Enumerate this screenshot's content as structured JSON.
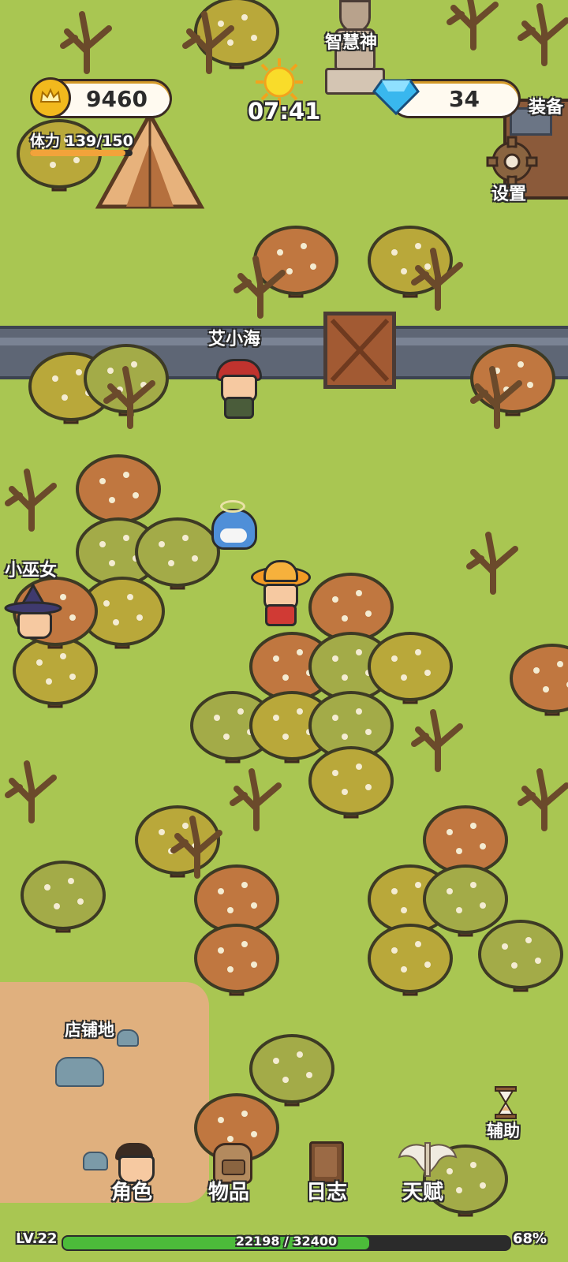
{
  "hud": {
    "gold": "9460",
    "gems": "34",
    "time": "07:41",
    "stamina_label": "体力 139/150",
    "stamina_fraction": 0.93,
    "settings_label": "设置",
    "equipment_label": "装备",
    "assist_label": "辅助"
  },
  "world": {
    "statue_label": "智慧神",
    "npc_pirate": "艾小海",
    "npc_witch": "小巫女",
    "shop_area": "店铺地"
  },
  "menu": {
    "character": "角色",
    "items": "物品",
    "journal": "日志",
    "talent": "天赋"
  },
  "status": {
    "level": "LV.22",
    "xp": "22198 / 32400",
    "xp_fraction": 0.685,
    "percent": "68%"
  },
  "colors": {
    "grass": "#a9c652",
    "dirt": "#e0b07e",
    "wall": "#5e6675",
    "xp_fill": "#4cbb3a",
    "gold": "#f2b91d",
    "gem": "#39b7ee"
  },
  "icons": [
    "coin-icon",
    "gem-icon",
    "sun-icon",
    "gear-icon",
    "hourglass-icon",
    "character-icon",
    "backpack-icon",
    "book-icon",
    "wings-icon"
  ]
}
